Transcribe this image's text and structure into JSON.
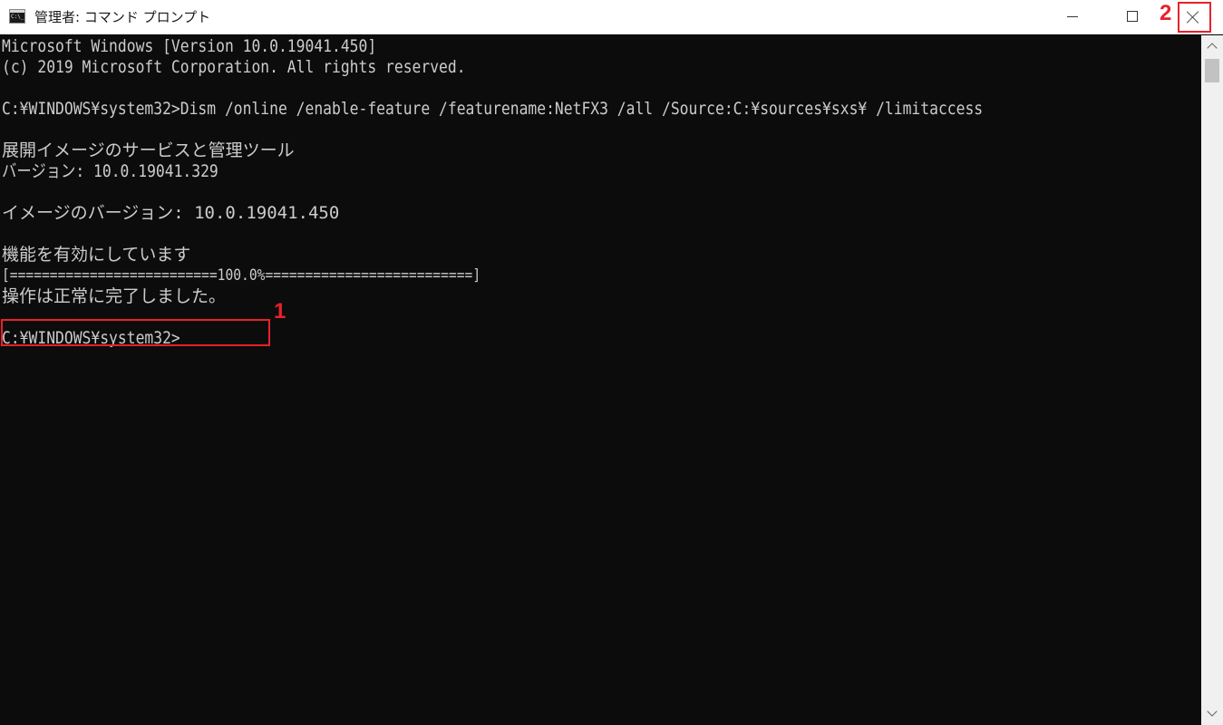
{
  "window": {
    "title": "管理者: コマンド プロンプト"
  },
  "annotations": {
    "result_step": "1",
    "close_step": "2",
    "highlight_color": "#e8212a"
  },
  "console": {
    "lines": [
      "Microsoft Windows [Version 10.0.19041.450]",
      "(c) 2019 Microsoft Corporation. All rights reserved.",
      "C:¥WINDOWS¥system32>Dism /online /enable-feature /featurename:NetFX3 /all /Source:C:¥sources¥sxs¥ /limitaccess",
      "展開イメージのサービスと管理ツール",
      "バージョン: 10.0.19041.329",
      "イメージのバージョン: 10.0.19041.450",
      "機能を有効にしています",
      "[==========================100.0%==========================]",
      "操作は正常に完了しました。",
      "C:¥WINDOWS¥system32>"
    ],
    "text_color": "#cccccc",
    "background_color": "#0c0c0c"
  },
  "icons": {
    "app": "cmd-icon",
    "minimize": "minimize-icon",
    "maximize": "maximize-icon",
    "close": "close-icon",
    "scroll_up": "chevron-up-icon",
    "scroll_down": "chevron-down-icon"
  }
}
